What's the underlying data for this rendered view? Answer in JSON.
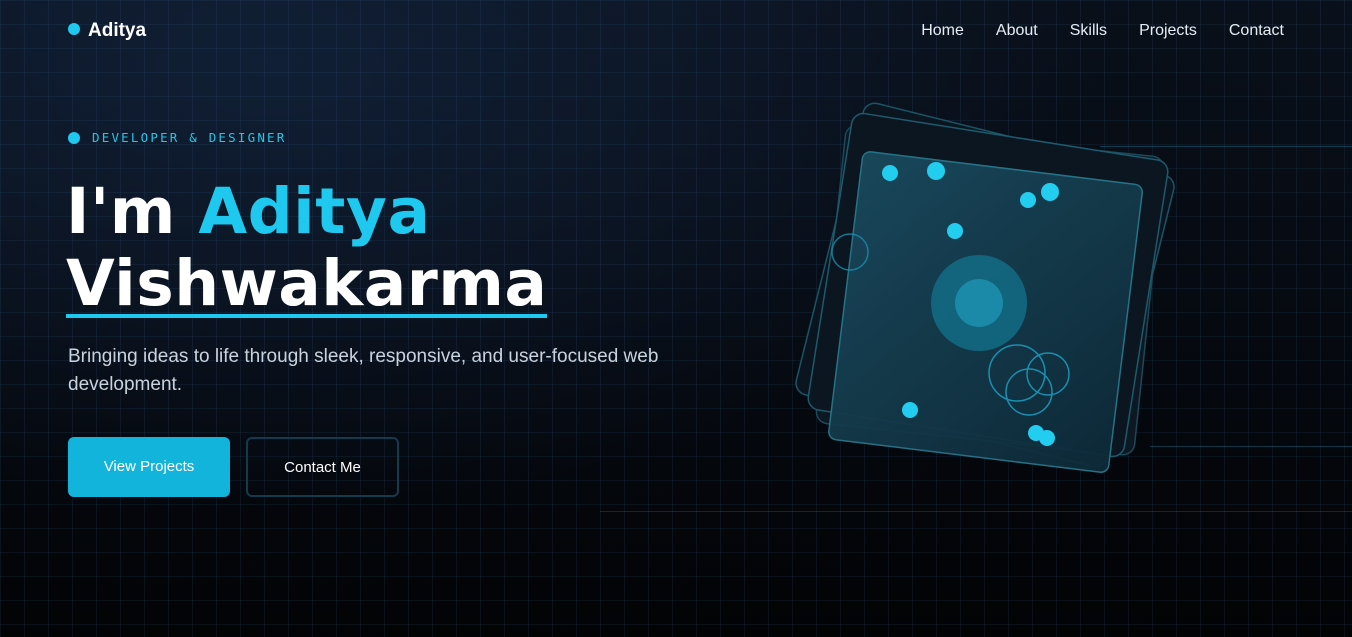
{
  "nav": {
    "logo": "Aditya",
    "links": [
      "Home",
      "About",
      "Skills",
      "Projects",
      "Contact"
    ]
  },
  "hero": {
    "eyebrow": "DEVELOPER & DESIGNER",
    "title_prefix": "I'm ",
    "title_accent": "Aditya",
    "title_line2": "Vishwakarma",
    "subtitle": "Bringing ideas to life through sleek, responsive, and user-focused web development.",
    "primary_button": "View Projects",
    "secondary_button": "Contact Me"
  },
  "colors": {
    "accent": "#1ec8ee",
    "background": "#05080f",
    "button_primary": "#12b4dc"
  },
  "icons": [
    "logo-dot-icon",
    "eyebrow-dot-icon"
  ]
}
